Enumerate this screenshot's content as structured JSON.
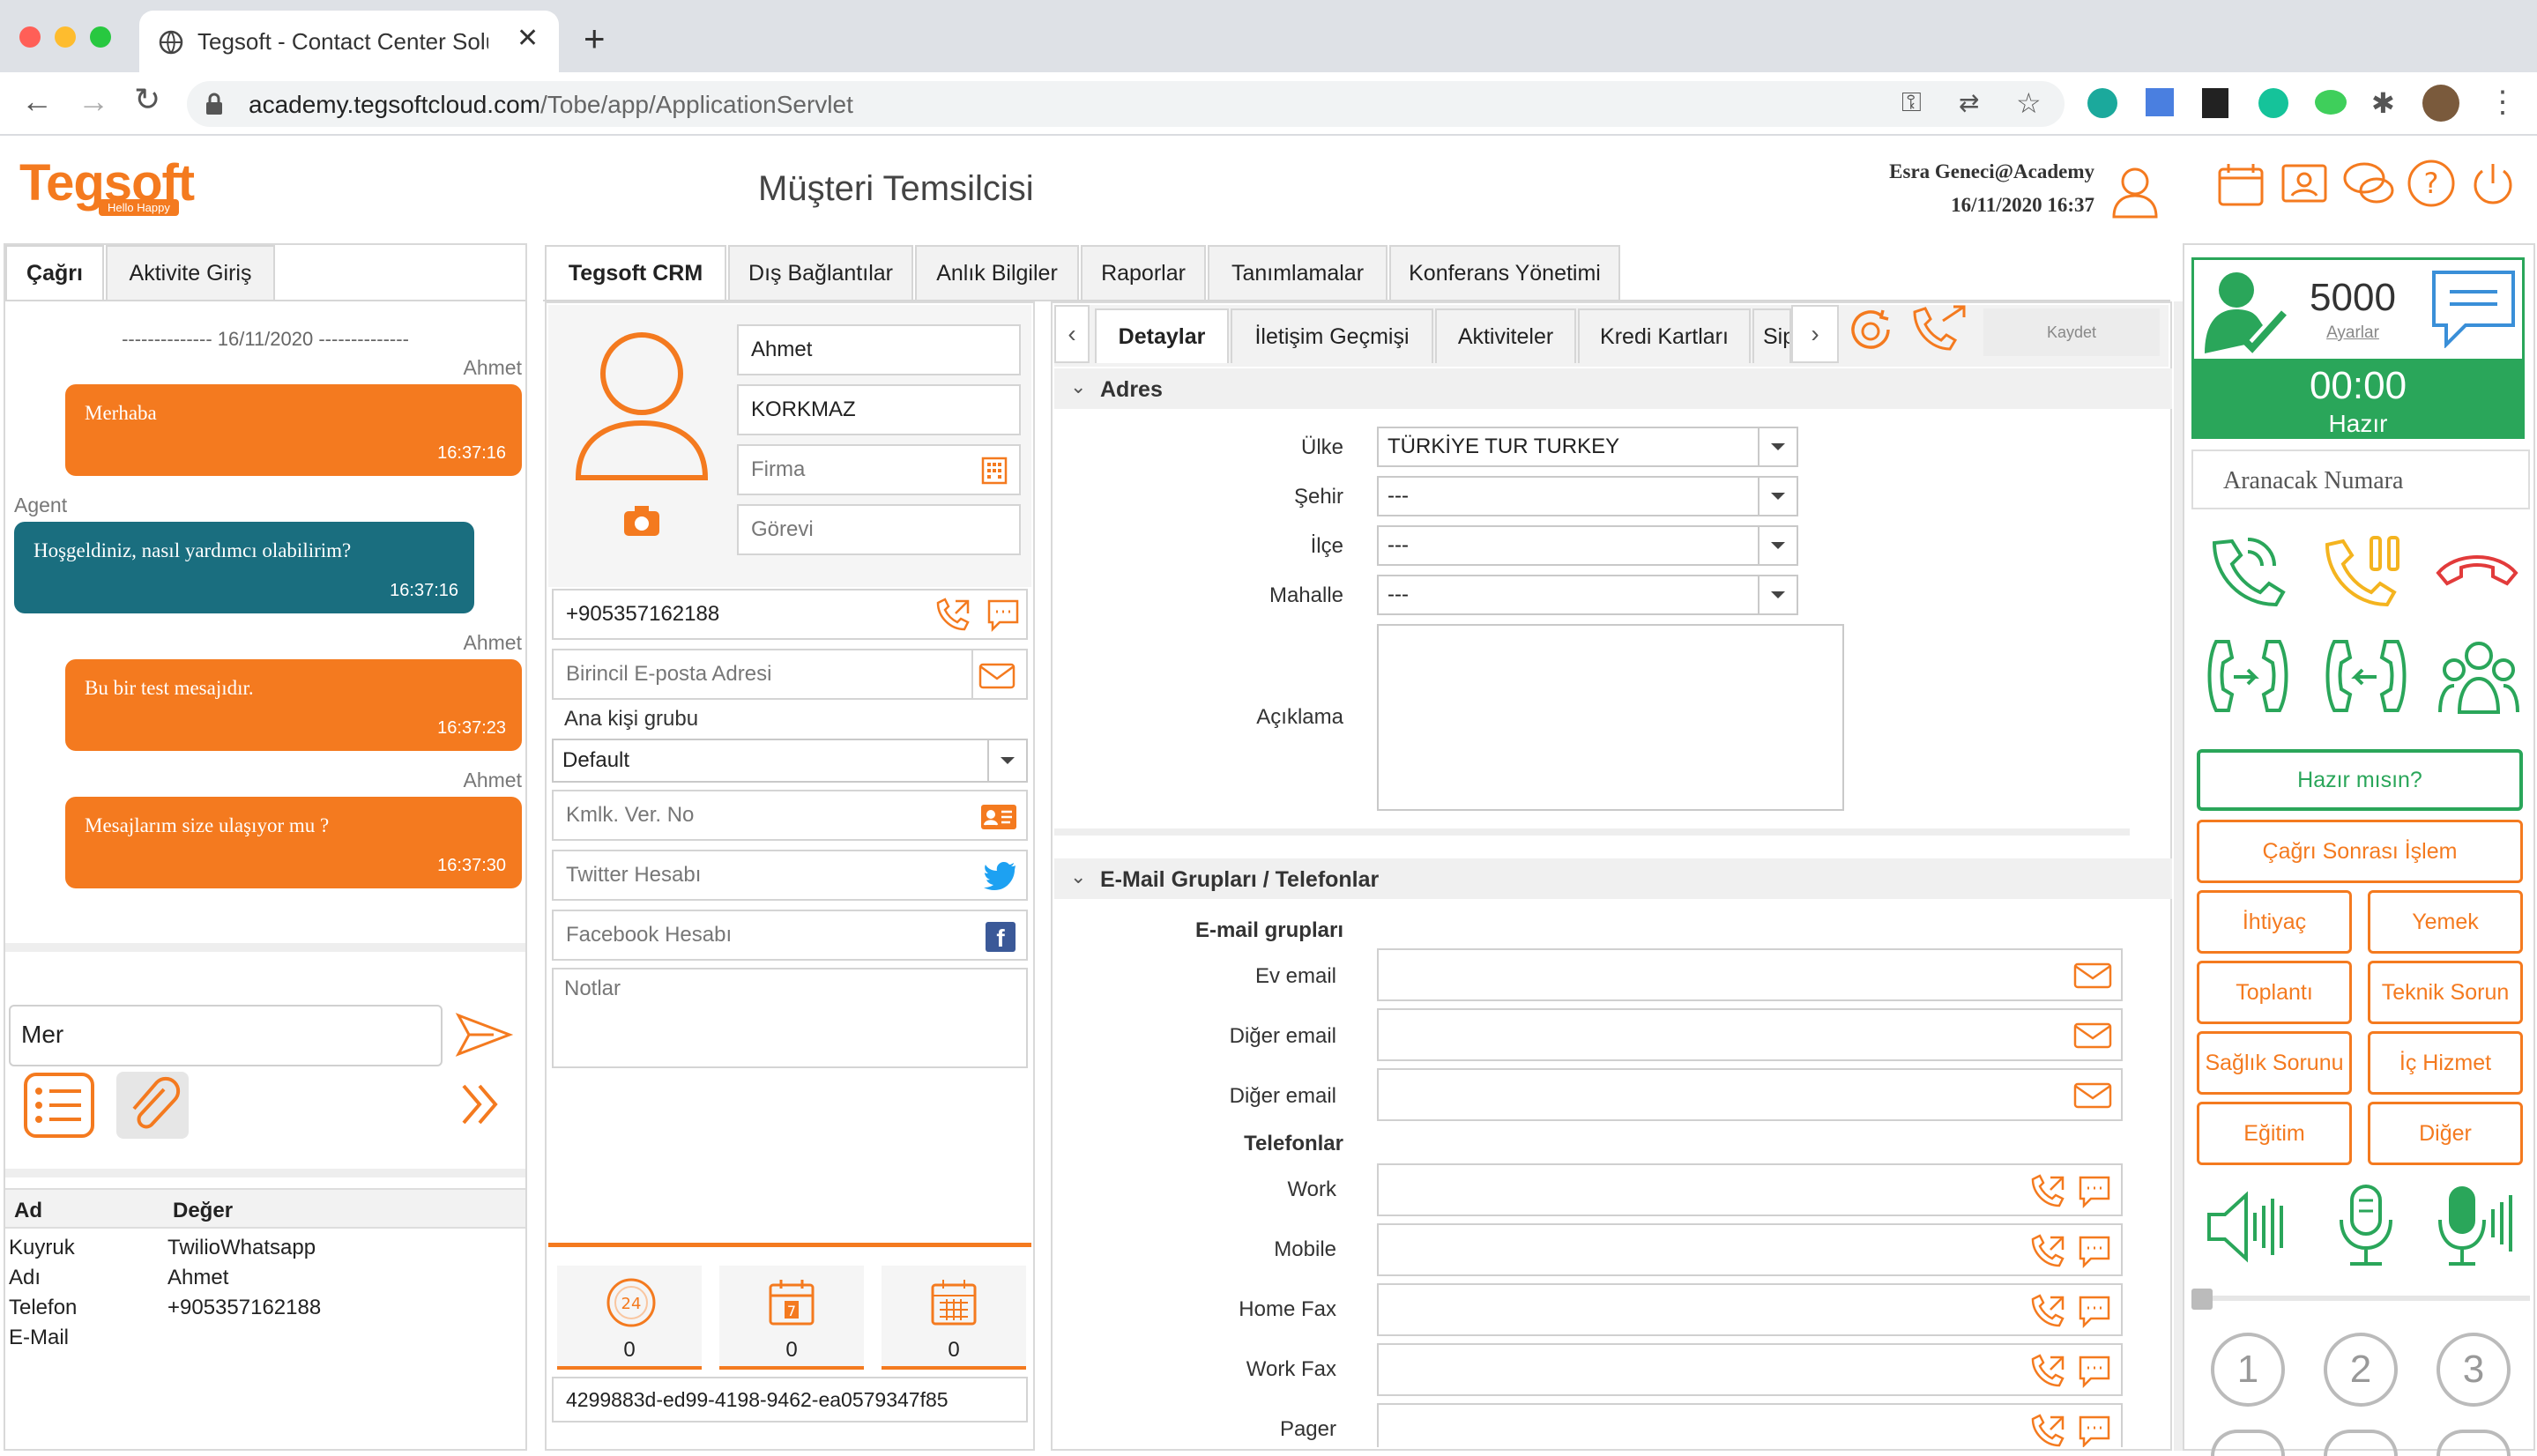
{
  "browser": {
    "tab_title": "Tegsoft - Contact Center Soluti",
    "url_host": "academy.tegsoftcloud.com",
    "url_path": "/Tobe/app/ApplicationServlet"
  },
  "header": {
    "logo_text": "Tegsoft",
    "logo_tagline": "Hello Happy",
    "page_title": "Müşteri Temsilcisi",
    "user": "Esra Geneci@Academy",
    "datetime": "16/11/2020 16:37"
  },
  "chat": {
    "tabs": [
      "Çağrı",
      "Aktivite Giriş"
    ],
    "date_sep": "-------------- 16/11/2020 --------------",
    "messages": [
      {
        "sender": "Ahmet",
        "text": "Merhaba",
        "time": "16:37:16"
      },
      {
        "sender": "Agent",
        "text": "Hoşgeldiniz, nasıl yardımcı olabilirim?",
        "time": "16:37:16"
      },
      {
        "sender": "Ahmet",
        "text": "Bu bir test mesajıdır.",
        "time": "16:37:23"
      },
      {
        "sender": "Ahmet",
        "text": "Mesajlarım size ulaşıyor mu ?",
        "time": "16:37:30"
      }
    ],
    "input_value": "Mer",
    "table_headers": [
      "Ad",
      "Değer"
    ],
    "table_rows": [
      [
        "Kuyruk",
        "TwilioWhatsapp"
      ],
      [
        "Adı",
        "Ahmet"
      ],
      [
        "Telefon",
        "+905357162188"
      ],
      [
        "E-Mail",
        ""
      ]
    ]
  },
  "main_tabs": [
    "Tegsoft CRM",
    "Dış Bağlantılar",
    "Anlık Bilgiler",
    "Raporlar",
    "Tanımlamalar",
    "Konferans Yönetimi"
  ],
  "contact": {
    "first_name": "Ahmet",
    "last_name": "KORKMAZ",
    "company_ph": "Firma",
    "title_ph": "Görevi",
    "phone": "+905357162188",
    "email_ph": "Birincil E-posta Adresi",
    "group_label": "Ana kişi grubu",
    "group_value": "Default",
    "id_ph": "Kmlk. Ver. No",
    "twitter_ph": "Twitter Hesabı",
    "facebook_ph": "Facebook Hesabı",
    "notes_ph": "Notlar",
    "counters": [
      "0",
      "0",
      "0"
    ],
    "guid": "4299883d-ed99-4198-9462-ea0579347f85"
  },
  "detail": {
    "tabs": [
      "Detaylar",
      "İletişim Geçmişi",
      "Aktiviteler",
      "Kredi Kartları",
      "Sip"
    ],
    "save": "Kaydet",
    "address_title": "Adres",
    "address": [
      {
        "label": "Ülke",
        "value": "TÜRKİYE TUR TURKEY"
      },
      {
        "label": "Şehir",
        "value": "---"
      },
      {
        "label": "İlçe",
        "value": "---"
      },
      {
        "label": "Mahalle",
        "value": "---"
      }
    ],
    "desc_label": "Açıklama",
    "email_section": "E-Mail Grupları / Telefonlar",
    "email_groups_label": "E-mail grupları",
    "emails": [
      "Ev email",
      "Diğer email",
      "Diğer email"
    ],
    "phones_label": "Telefonlar",
    "phones": [
      "Work",
      "Mobile",
      "Home Fax",
      "Work Fax",
      "Pager"
    ]
  },
  "agent": {
    "ext": "5000",
    "settings": "Ayarlar",
    "timer": "00:00",
    "status": "Hazır",
    "dial_ph": "Aranacak Numara",
    "ready_btn": "Hazır mısın?",
    "after_call": "Çağrı Sonrası İşlem",
    "reasons": [
      "İhtiyaç",
      "Yemek",
      "Toplantı",
      "Teknik Sorun",
      "Sağlık Sorunu",
      "İç Hizmet",
      "Eğitim",
      "Diğer"
    ],
    "keypad": [
      "1",
      "2",
      "3"
    ],
    "accent": "#f47a1f",
    "status_color": "#2aa65a"
  }
}
